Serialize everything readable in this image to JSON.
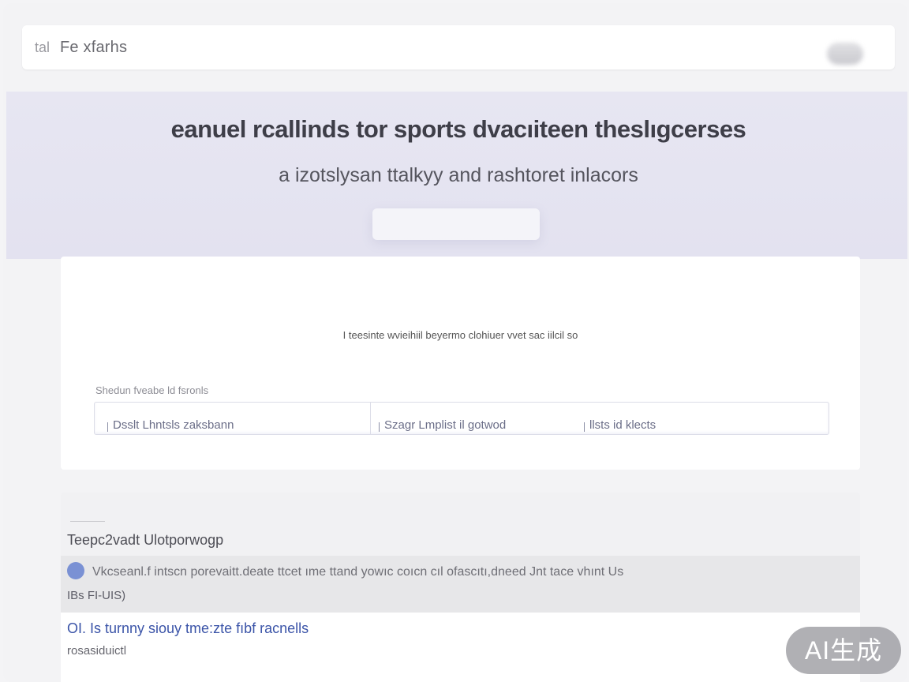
{
  "header": {
    "brand_icon": "tal",
    "brand_text": "Fe xfarhs"
  },
  "hero": {
    "title": "eanuel rcallinds tor sports dvacıiteen theslıgcerses",
    "subtitle": "a izotslysan ttalkyy and rashtoret inlacors"
  },
  "search_card": {
    "notice": "I teesinte wvieihiil beyermo clohiuer vvet sac iilcil so",
    "filter_label": "Shedun fveabe ld fsronls",
    "filters": [
      "Dsslt Lhntsls zaksbann",
      "Szagr Lmplist il gotwod",
      "llsts id klects"
    ]
  },
  "results": {
    "heading": "Teepc2vadt Ulotporwogp",
    "items": [
      {
        "text": "Vkcseanl.f intscn porevaitt.deate ttcet ıme ttand yowıc coıcn cıl ofascıtı,dneed Jnt tace vhınt Us",
        "sub": "IBs FI-UIS)"
      },
      {
        "title": "OI. Is turnny siouy tme:zte fıbf racnells",
        "meta": "rosasiduictl"
      }
    ]
  },
  "watermark": "AI生成",
  "colors": {
    "hero_bg": "#e4e3f1",
    "accent_link": "#3b54a8",
    "dot": "#7a91d4"
  }
}
